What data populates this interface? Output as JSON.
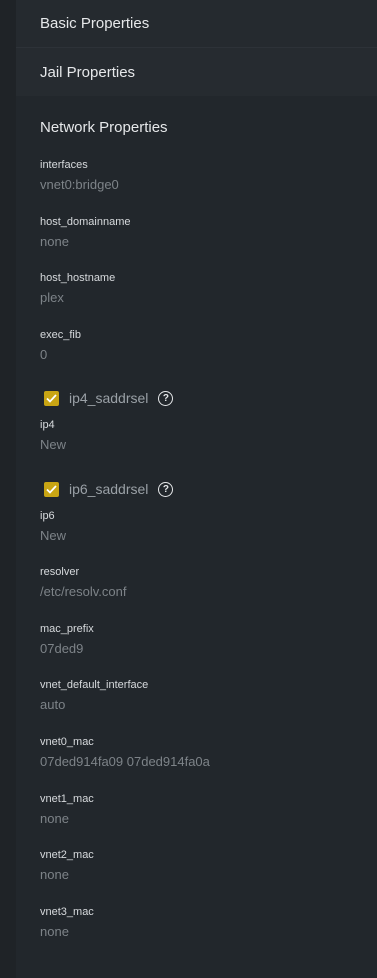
{
  "headers": {
    "basic": "Basic Properties",
    "jail": "Jail Properties",
    "network": "Network Properties"
  },
  "fields": {
    "interfaces": {
      "label": "interfaces",
      "value": "vnet0:bridge0"
    },
    "host_domainname": {
      "label": "host_domainname",
      "value": "none"
    },
    "host_hostname": {
      "label": "host_hostname",
      "value": "plex"
    },
    "exec_fib": {
      "label": "exec_fib",
      "value": "0"
    },
    "ip4": {
      "label": "ip4",
      "value": "New"
    },
    "ip6": {
      "label": "ip6",
      "value": "New"
    },
    "resolver": {
      "label": "resolver",
      "value": "/etc/resolv.conf"
    },
    "mac_prefix": {
      "label": "mac_prefix",
      "value": "07ded9"
    },
    "vnet_default_interface": {
      "label": "vnet_default_interface",
      "value": "auto"
    },
    "vnet0_mac": {
      "label": "vnet0_mac",
      "value": "07ded914fa09 07ded914fa0a"
    },
    "vnet1_mac": {
      "label": "vnet1_mac",
      "value": "none"
    },
    "vnet2_mac": {
      "label": "vnet2_mac",
      "value": "none"
    },
    "vnet3_mac": {
      "label": "vnet3_mac",
      "value": "none"
    }
  },
  "checkboxes": {
    "ip4_saddrsel": {
      "label": "ip4_saddrsel",
      "checked": true,
      "help": "?"
    },
    "ip6_saddrsel": {
      "label": "ip6_saddrsel",
      "checked": true,
      "help": "?"
    }
  },
  "colors": {
    "accent": "#c9a514",
    "background": "#1f2327",
    "panel": "#252a2f",
    "value_text": "#7d8388"
  }
}
